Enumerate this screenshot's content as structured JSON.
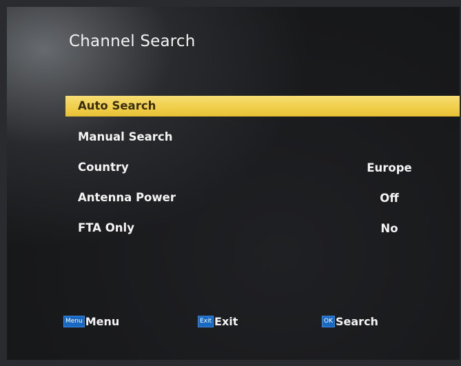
{
  "screen": {
    "title": "Channel Search"
  },
  "menu": {
    "items": [
      {
        "label": "Auto Search",
        "value": ""
      },
      {
        "label": "Manual Search",
        "value": ""
      },
      {
        "label": "Country",
        "value": "Europe"
      },
      {
        "label": "Antenna Power",
        "value": "Off"
      },
      {
        "label": "FTA Only",
        "value": "No"
      }
    ],
    "selected_index": 0
  },
  "footer": {
    "menu_key": "Menu",
    "menu_label": "Menu",
    "exit_key": "Exit",
    "exit_label": "Exit",
    "ok_key": "OK",
    "ok_label": "Search"
  },
  "colors": {
    "highlight": "#f1cf4c",
    "key_button": "#1769c4"
  },
  "icons": [
    "menu-key-icon",
    "exit-key-icon",
    "ok-key-icon"
  ]
}
